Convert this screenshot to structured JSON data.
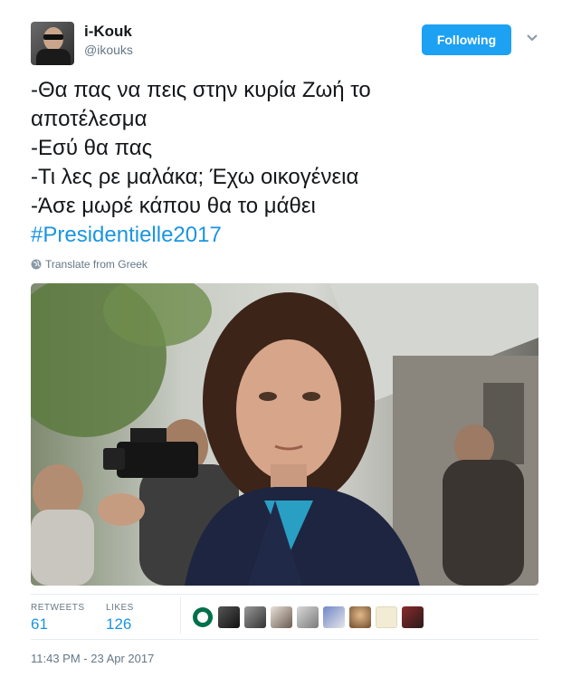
{
  "user": {
    "name": "i-Kouk",
    "handle": "@ikouks"
  },
  "follow_button": {
    "label": "Following"
  },
  "tweet": {
    "lines": [
      "-Θα πας να πεις στην κυρία Ζωή το",
      "αποτέλεσμα",
      "-Εσύ θα πας",
      "-Τι λες ρε μαλάκα; Έχω οικογένεια",
      "-Άσε μωρέ κάπου θα το μάθει"
    ],
    "hashtag": "#Presidentielle2017",
    "translate": "Translate from Greek"
  },
  "stats": {
    "retweets_label": "RETWEETS",
    "retweets": "61",
    "likes_label": "LIKES",
    "likes": "126"
  },
  "timestamp": "11:43 PM - 23 Apr 2017",
  "colors": {
    "accent": "#1da1f2",
    "link": "#1b95e0",
    "muted": "#657786"
  }
}
